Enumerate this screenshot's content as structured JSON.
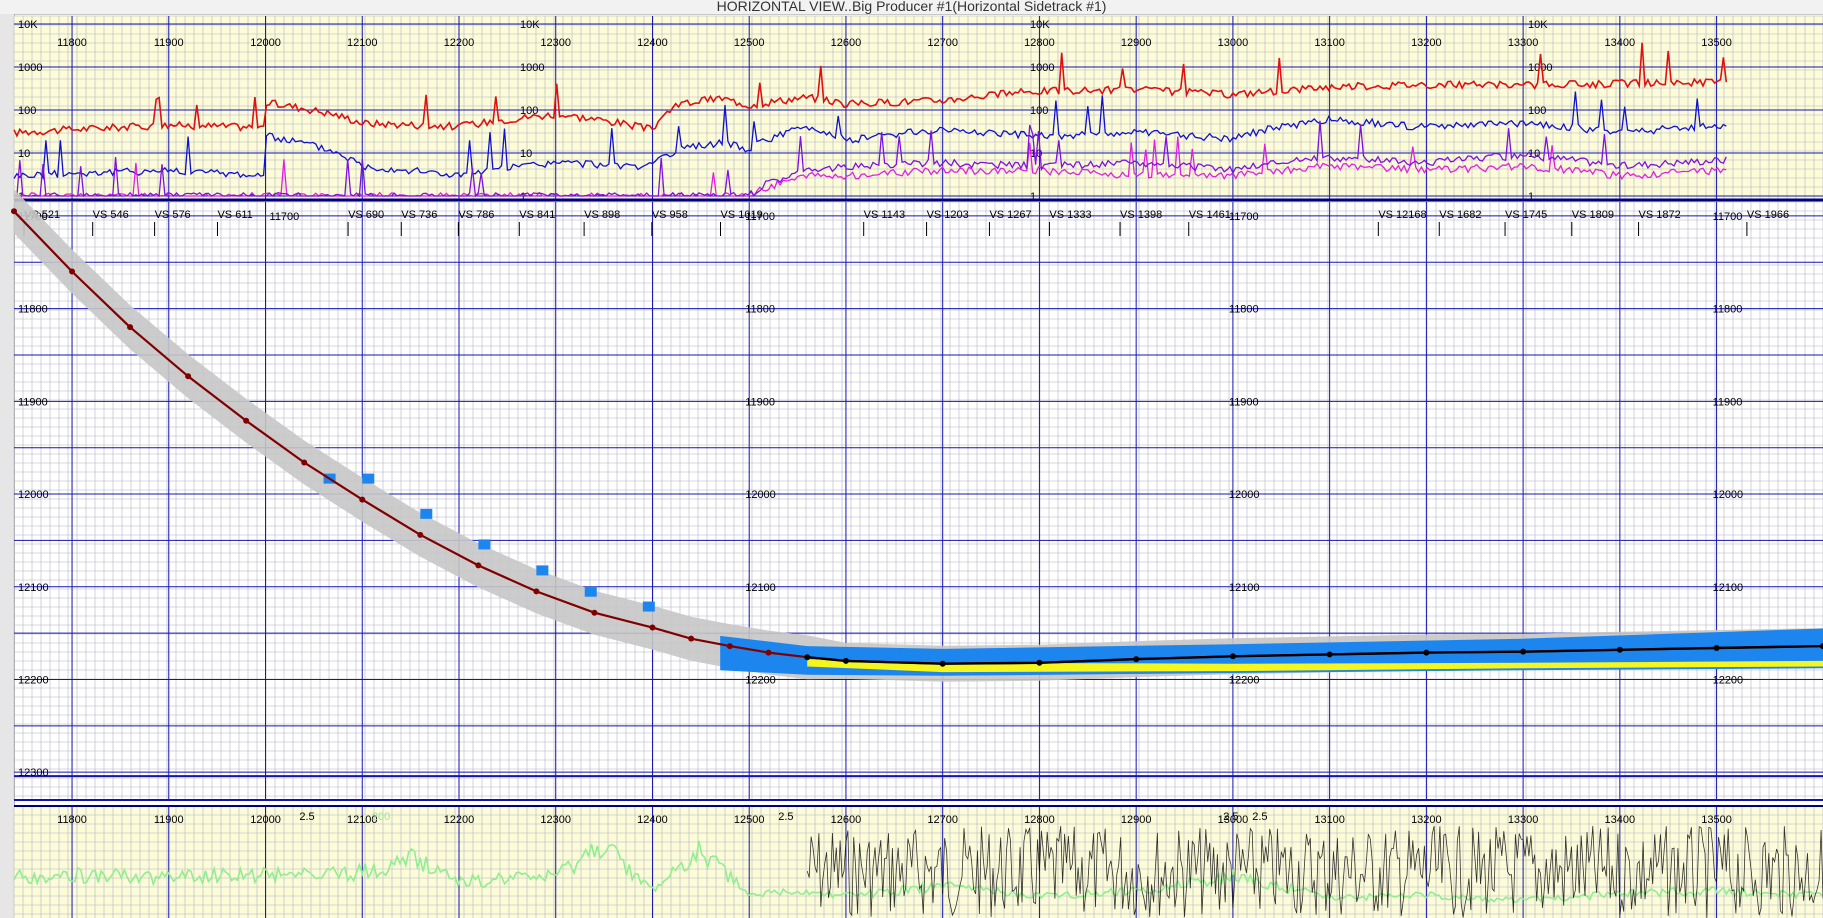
{
  "window": {
    "title": "HORIZONTAL VIEW..Big Producer #1(Horizontal Sidetrack #1)"
  },
  "colors": {
    "grid_minor": "#b4b4c6",
    "grid_major": "#1414b4",
    "track_bg": "#fcfcd8",
    "gamma": "#e01010",
    "resistivity": "#1010d0",
    "magenta": "#e020e0",
    "purple": "#8010e0",
    "wellpath": "#800000",
    "target_blue": "#1c86ee",
    "target_yellow": "#f5f520",
    "envelope": "#c6c6c6",
    "green_curve": "#90ee90"
  },
  "chart_data": [
    {
      "type": "line",
      "name": "top-log-track",
      "x": [
        11740,
        11900,
        12000,
        12000,
        12100,
        12200,
        12300,
        12400,
        12430,
        12470,
        12500,
        12560,
        12600,
        12700,
        12800,
        12900,
        13000,
        13100,
        13200,
        13300,
        13400,
        13510
      ],
      "series": [
        {
          "values": [
            30,
            45,
            40,
            150,
            50,
            42,
            80,
            35,
            140,
            190,
            130,
            200,
            140,
            170,
            280,
            300,
            230,
            350,
            400,
            380,
            420,
            450
          ]
        },
        {
          "values": [
            3,
            4,
            3,
            25,
            5,
            3,
            6,
            5,
            12,
            18,
            12,
            40,
            20,
            35,
            25,
            30,
            22,
            60,
            40,
            50,
            30,
            45
          ]
        },
        {
          "values": [
            1,
            1,
            1,
            1,
            1,
            1,
            1,
            1,
            1,
            1,
            1,
            3,
            3,
            4,
            4,
            3,
            3,
            5,
            4,
            5,
            3,
            4
          ]
        },
        {
          "values": [
            1,
            1,
            1,
            1,
            1,
            1,
            1,
            1,
            1,
            1,
            1,
            4,
            5,
            6,
            5,
            6,
            4,
            8,
            6,
            9,
            5,
            7
          ]
        }
      ],
      "x_ticks": [
        "11800",
        "11900",
        "12000",
        "12100",
        "12200",
        "12300",
        "12400",
        "12500",
        "12600",
        "12700",
        "12800",
        "12900",
        "13000",
        "13100",
        "13200",
        "13300",
        "13400",
        "13500"
      ],
      "y_ticks": [
        "10K",
        "1000",
        "100",
        "10",
        "1"
      ],
      "yscale": "log",
      "ylim": [
        1,
        10000
      ],
      "xlim": [
        11740,
        13610
      ]
    },
    {
      "type": "line",
      "name": "cross-section",
      "vs_labels": [
        "VS 521",
        "VS 546",
        "VS 576",
        "VS 611",
        "VS 690",
        "VS 736",
        "VS 786",
        "VS 841",
        "VS 898",
        "VS 958",
        "VS 1019",
        "VS 1143",
        "VS 1203",
        "VS 1267",
        "VS 1333",
        "VS 1398",
        "VS 1461",
        "VS 12168",
        "VS 1682",
        "VS 1745",
        "VS 1809",
        "VS 1872",
        "VS 1966"
      ],
      "vs_positions": [
        11740,
        11811,
        11875,
        11940,
        12075,
        12130,
        12189,
        12252,
        12319,
        12389,
        12460,
        12608,
        12673,
        12738,
        12800,
        12873,
        12944,
        13140,
        13203,
        13271,
        13340,
        13409,
        13521
      ],
      "depth_ticks": [
        "11700",
        "11800",
        "11900",
        "12000",
        "12100",
        "12200",
        "12300"
      ],
      "tick_columns_x": [
        11740,
        12500,
        13000,
        13500
      ],
      "ylim": [
        11685,
        12330
      ],
      "wellpath": {
        "x": [
          11740,
          11800,
          11860,
          11920,
          11980,
          12040,
          12100,
          12160,
          12220,
          12280,
          12340,
          12400,
          12440,
          12480,
          12520,
          12560,
          12600,
          12700,
          12800,
          12900,
          13000,
          13100,
          13200,
          13300,
          13400,
          13500,
          13610
        ],
        "depth": [
          11695,
          11760,
          11820,
          11873,
          11921,
          11966,
          12006,
          12044,
          12077,
          12105,
          12128,
          12144,
          12156,
          12164,
          12171,
          12176,
          12180,
          12183,
          12182,
          12178,
          12175,
          12173,
          12171,
          12170,
          12168,
          12166,
          12164
        ]
      },
      "target_blue": {
        "x": [
          12470,
          12560,
          12700,
          13000,
          13300,
          13610
        ],
        "top": [
          12153,
          12164,
          12167,
          12162,
          12156,
          12145
        ],
        "base": [
          12190,
          12195,
          12196,
          12193,
          12190,
          12188
        ]
      },
      "target_yellow": {
        "x": [
          12560,
          12700,
          13000,
          13300,
          13610
        ],
        "top": [
          12178,
          12182,
          12183,
          12182,
          12180
        ],
        "base": [
          12186,
          12192,
          12191,
          12188,
          12186
        ]
      }
    },
    {
      "type": "line",
      "name": "bottom-log-track",
      "x_ticks": [
        "11800",
        "11900",
        "12000",
        "12100",
        "12200",
        "12300",
        "12400",
        "12500",
        "12600",
        "12700",
        "12800",
        "12900",
        "13000",
        "13100",
        "13200",
        "13300",
        "13400",
        "13500"
      ],
      "scale_labels": [
        "2.5",
        "200",
        "2.5",
        "2.5",
        "2.5"
      ],
      "series": [
        {
          "x": [
            11740,
            11800,
            11900,
            12000,
            12100,
            12150,
            12200,
            12300,
            12350,
            12400,
            12450,
            12500,
            12550,
            12600,
            12700,
            12800,
            12900,
            13000,
            13100,
            13200,
            13300,
            13400,
            13500,
            13610
          ],
          "values": [
            40,
            42,
            40,
            43,
            45,
            60,
            35,
            40,
            75,
            25,
            70,
            20,
            25,
            20,
            30,
            20,
            25,
            40,
            18,
            20,
            15,
            22,
            25,
            20
          ]
        }
      ],
      "ylim": [
        0,
        100
      ],
      "xlim": [
        11740,
        13610
      ]
    }
  ]
}
